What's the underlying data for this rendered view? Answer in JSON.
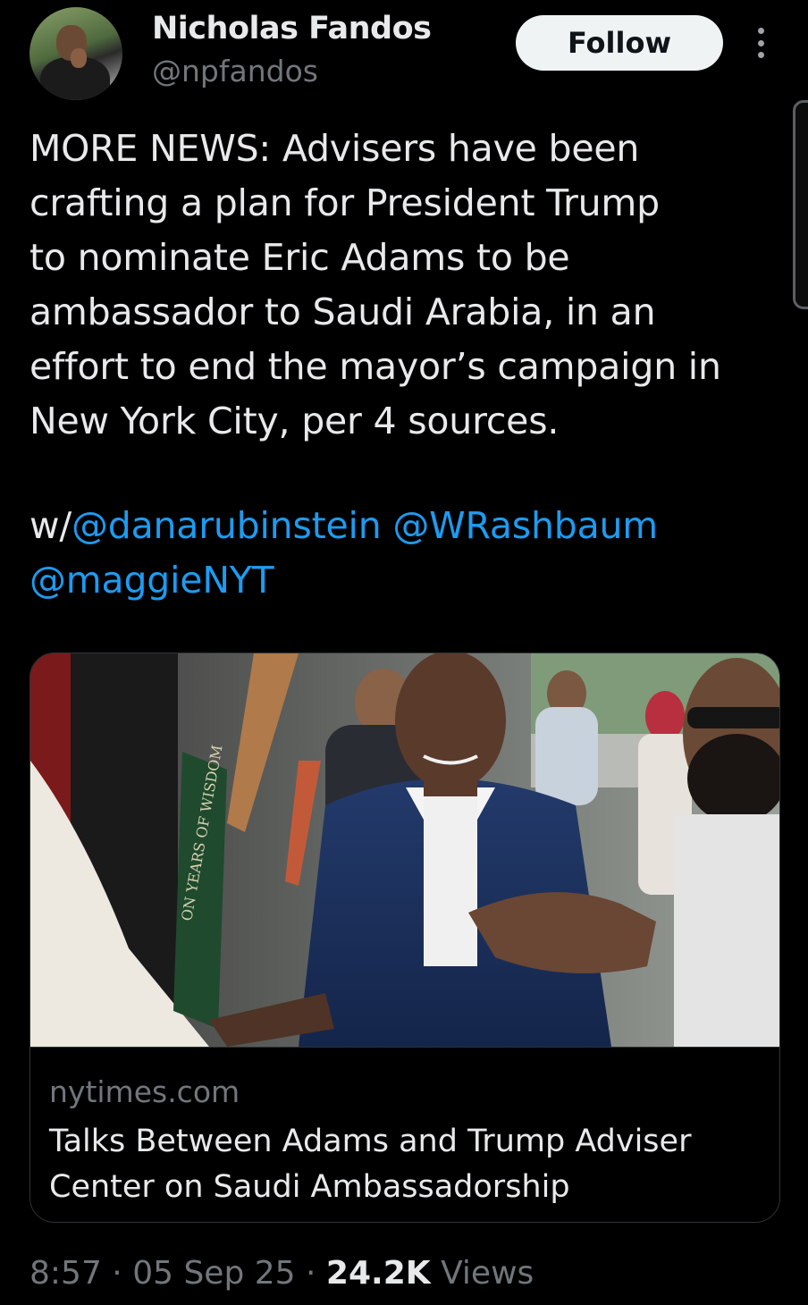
{
  "author": {
    "name": "Nicholas Fandos",
    "handle": "@npfandos",
    "avatar_icon": "profile-photo"
  },
  "actions": {
    "follow_label": "Follow",
    "more_icon": "more-vertical-icon"
  },
  "tweet": {
    "lines": [
      "MORE NEWS: Advisers have been",
      "crafting a plan for President Trump",
      "to nominate Eric Adams to be",
      "ambassador to Saudi Arabia, in an",
      "effort to end the mayor’s campaign in",
      "New York City, per 4 sources."
    ],
    "mentions_prefix": "w/",
    "mentions": [
      "@danarubinstein",
      "@WRashbaum",
      "@maggieNYT"
    ]
  },
  "card": {
    "domain": "nytimes.com",
    "title": "Talks Between Adams and Trump Adviser Center on Saudi Ambassadorship",
    "sign_text": "ON YEARS OF WISDOM"
  },
  "footer": {
    "time": "8:57",
    "separator": "·",
    "date": "05 Sep 25",
    "views_count": "24.2K",
    "views_label": "Views"
  },
  "colors": {
    "background": "#000000",
    "text": "#e7e9ea",
    "secondary": "#71767b",
    "link": "#1d9bf0",
    "border": "#2f3336"
  }
}
